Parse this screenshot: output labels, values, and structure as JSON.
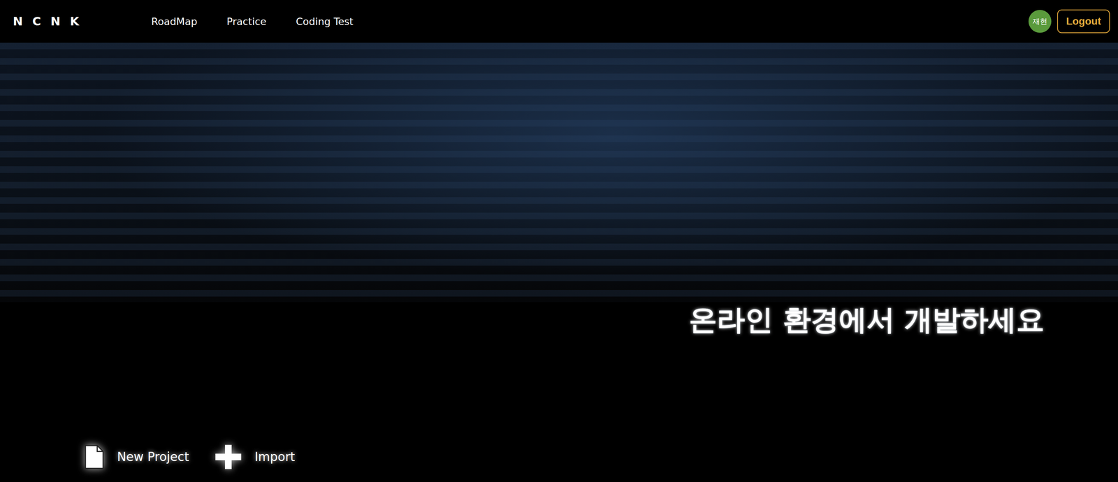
{
  "header": {
    "logo": "NCNK",
    "nav": [
      {
        "label": "RoadMap"
      },
      {
        "label": "Practice"
      },
      {
        "label": "Coding Test"
      }
    ],
    "user": {
      "avatar": "재현"
    },
    "logout": "Logout"
  },
  "banner": {
    "headline": "온라인 환경에서 개발하세요"
  },
  "actions": [
    {
      "label": "New Project",
      "kind": "file"
    },
    {
      "label": "Import",
      "kind": "plus"
    }
  ]
}
